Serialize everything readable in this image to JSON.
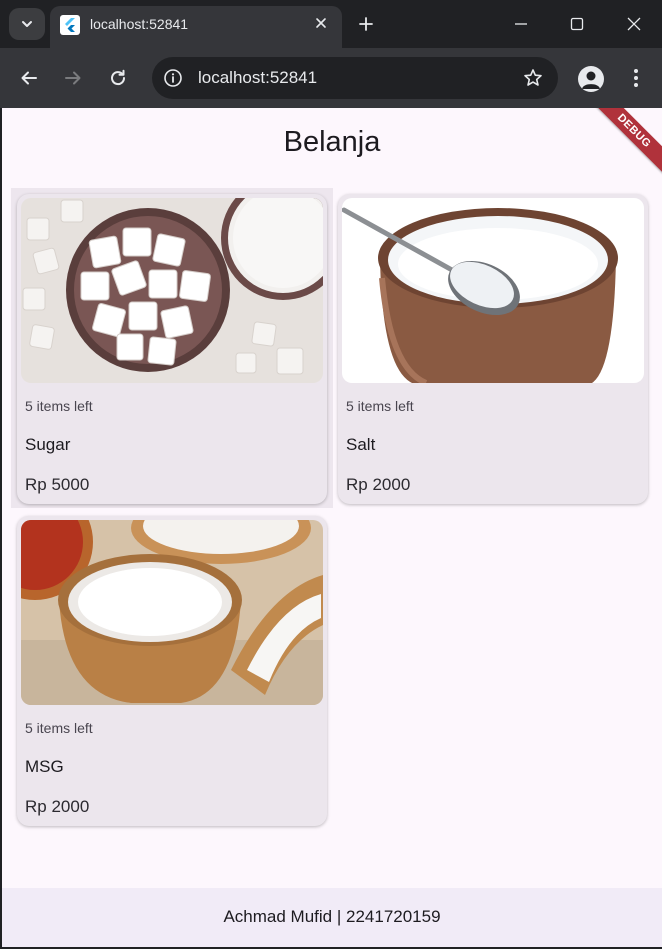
{
  "browser": {
    "tab_title": "localhost:52841",
    "url": "localhost:52841",
    "icons": {
      "tab_search": "chevron-down-icon",
      "close_tab": "close-icon",
      "new_tab": "plus-icon",
      "back": "arrow-left-icon",
      "forward": "arrow-right-icon",
      "reload": "reload-icon",
      "site_info": "info-icon",
      "bookmark": "star-icon",
      "profile": "person-icon",
      "menu": "kebab-icon"
    }
  },
  "app": {
    "title": "Belanja",
    "debug_banner": "DEBUG",
    "products": [
      {
        "name": "Sugar",
        "stock": "5 items left",
        "price": "Rp 5000",
        "image": "sugar-cubes-photo"
      },
      {
        "name": "Salt",
        "stock": "5 items left",
        "price": "Rp 2000",
        "image": "salt-bowl-photo"
      },
      {
        "name": "MSG",
        "stock": "5 items left",
        "price": "Rp 2000",
        "image": "msg-bowl-photo"
      }
    ],
    "footer": {
      "author": "Achmad Mufid",
      "separator": " | ",
      "student_id": "2241720159"
    }
  },
  "colors": {
    "browser_dark": "#202124",
    "toolbar": "#35363a",
    "app_background": "#fdf7fd",
    "card_background": "#ece6ed",
    "footer_background": "#f1ebf7",
    "debug_banner": "#b0323b"
  }
}
